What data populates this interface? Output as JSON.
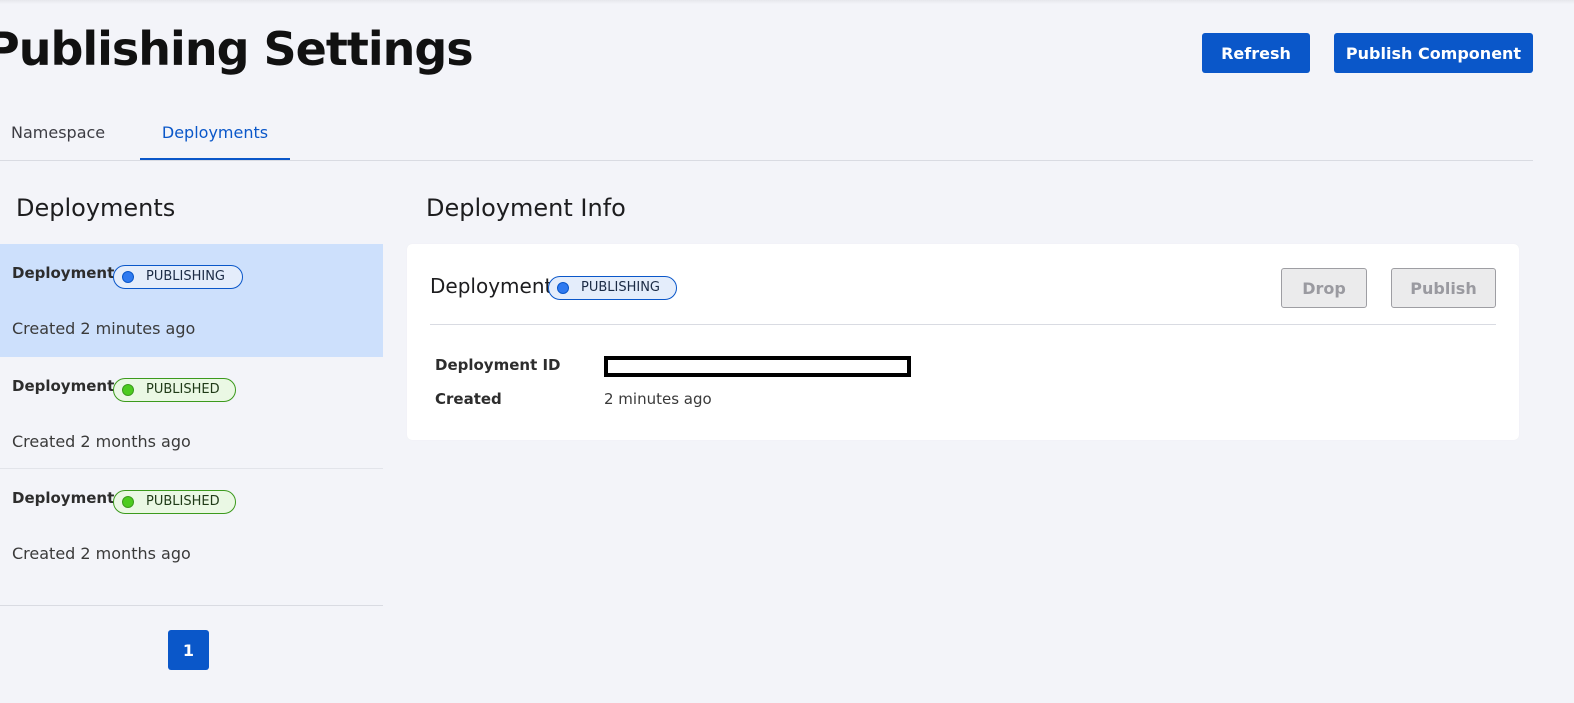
{
  "page": {
    "title": "Publishing Settings"
  },
  "header": {
    "refresh_label": "Refresh",
    "publish_component_label": "Publish Component"
  },
  "tabs": [
    {
      "label": "Namespace",
      "active": false
    },
    {
      "label": "Deployments",
      "active": true
    }
  ],
  "deployments_panel": {
    "title": "Deployments",
    "items": [
      {
        "name": "Deployment",
        "status": "PUBLISHING",
        "created": "Created 2 minutes ago",
        "selected": true
      },
      {
        "name": "Deployment",
        "status": "PUBLISHED",
        "created": "Created 2 months ago",
        "selected": false
      },
      {
        "name": "Deployment",
        "status": "PUBLISHED",
        "created": "Created 2 months ago",
        "selected": false
      }
    ],
    "pagination": {
      "current_page": "1"
    }
  },
  "info_panel": {
    "title": "Deployment Info",
    "heading": "Deployment",
    "status": "PUBLISHING",
    "drop_label": "Drop",
    "publish_label": "Publish",
    "fields": {
      "id_label": "Deployment ID",
      "created_label": "Created",
      "created_value": "2 minutes ago"
    }
  },
  "colors": {
    "primary": "#0a57c9",
    "selected_row": "#cde0fc",
    "publishing_dot": "#2f7af0",
    "published_dot": "#4ccc1f",
    "background": "#f3f4f9"
  },
  "icons": {
    "status_dot": "status-dot-icon"
  }
}
